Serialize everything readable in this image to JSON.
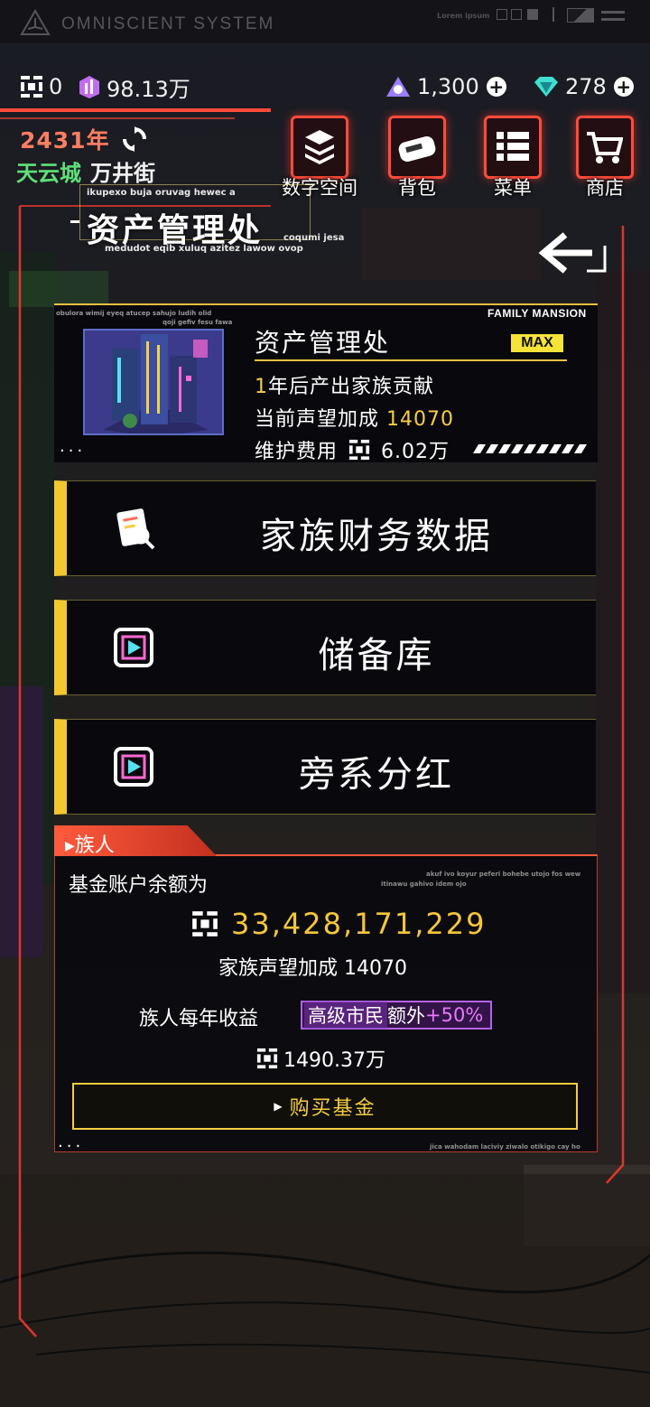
{
  "system": {
    "title": "OMNISCIENT SYSTEM",
    "tag": "Lorem ipsum"
  },
  "resources": {
    "coins": "0",
    "crystals": "98.13万",
    "energy": "1,300",
    "gems": "278"
  },
  "location": {
    "year": "2431",
    "year_unit": "年",
    "city": "天云城",
    "street": "万井街"
  },
  "nav": [
    {
      "label": "数字空间",
      "icon": "layers-icon"
    },
    {
      "label": "背包",
      "icon": "bag-icon"
    },
    {
      "label": "菜单",
      "icon": "menu-icon"
    },
    {
      "label": "商店",
      "icon": "cart-icon"
    }
  ],
  "header": {
    "title": "资产管理处",
    "tag_top": "ikupexo buja oruvag hewec a",
    "tag_right": "coqumi jesa",
    "tag_bottom": "medudot eqib xuluq azitez lawow ovop"
  },
  "mansion": {
    "head": "FAMILY MANSION",
    "small1": "obulora wimij eyeq atucep sahujo ludih olid",
    "small2": "qoji gefiv fesu fawa",
    "name": "资产管理处",
    "level": "MAX",
    "output_num": "1",
    "output_text": "年后产出家族贡献",
    "prestige_label": "当前声望加成",
    "prestige_value": "14070",
    "maint_label": "维护费用",
    "maint_value": "6.02万",
    "dots": "..."
  },
  "options": [
    {
      "label": "家族财务数据",
      "icon": "finance-report-icon"
    },
    {
      "label": "储备库",
      "icon": "reserve-vault-icon"
    },
    {
      "label": "旁系分红",
      "icon": "dividend-icon"
    }
  ],
  "clan": {
    "tab": "族人",
    "balance_label": "基金账户余额为",
    "small_r1": "akuf ivo koyur peferi bohebe utojo fos wew",
    "small_r2": "itinawu gahivo idem ojo",
    "balance": "33,428,171,229",
    "prestige_label": "家族声望加成",
    "prestige_value": "14070",
    "income_label": "族人每年收益",
    "vip_tier": "高级市民",
    "vip_extra": "额外",
    "vip_bonus": "+50%",
    "income_value": "1490.37万",
    "buy_label": "购买基金",
    "dots": "...",
    "small_bottom": "jica wahodam laciviy ziwalo otikigo cay ho"
  },
  "colors": {
    "accent_red": "#ff4b3a",
    "accent_yellow": "#f5cd45",
    "green": "#5fe07a",
    "purple": "#b462e8"
  }
}
